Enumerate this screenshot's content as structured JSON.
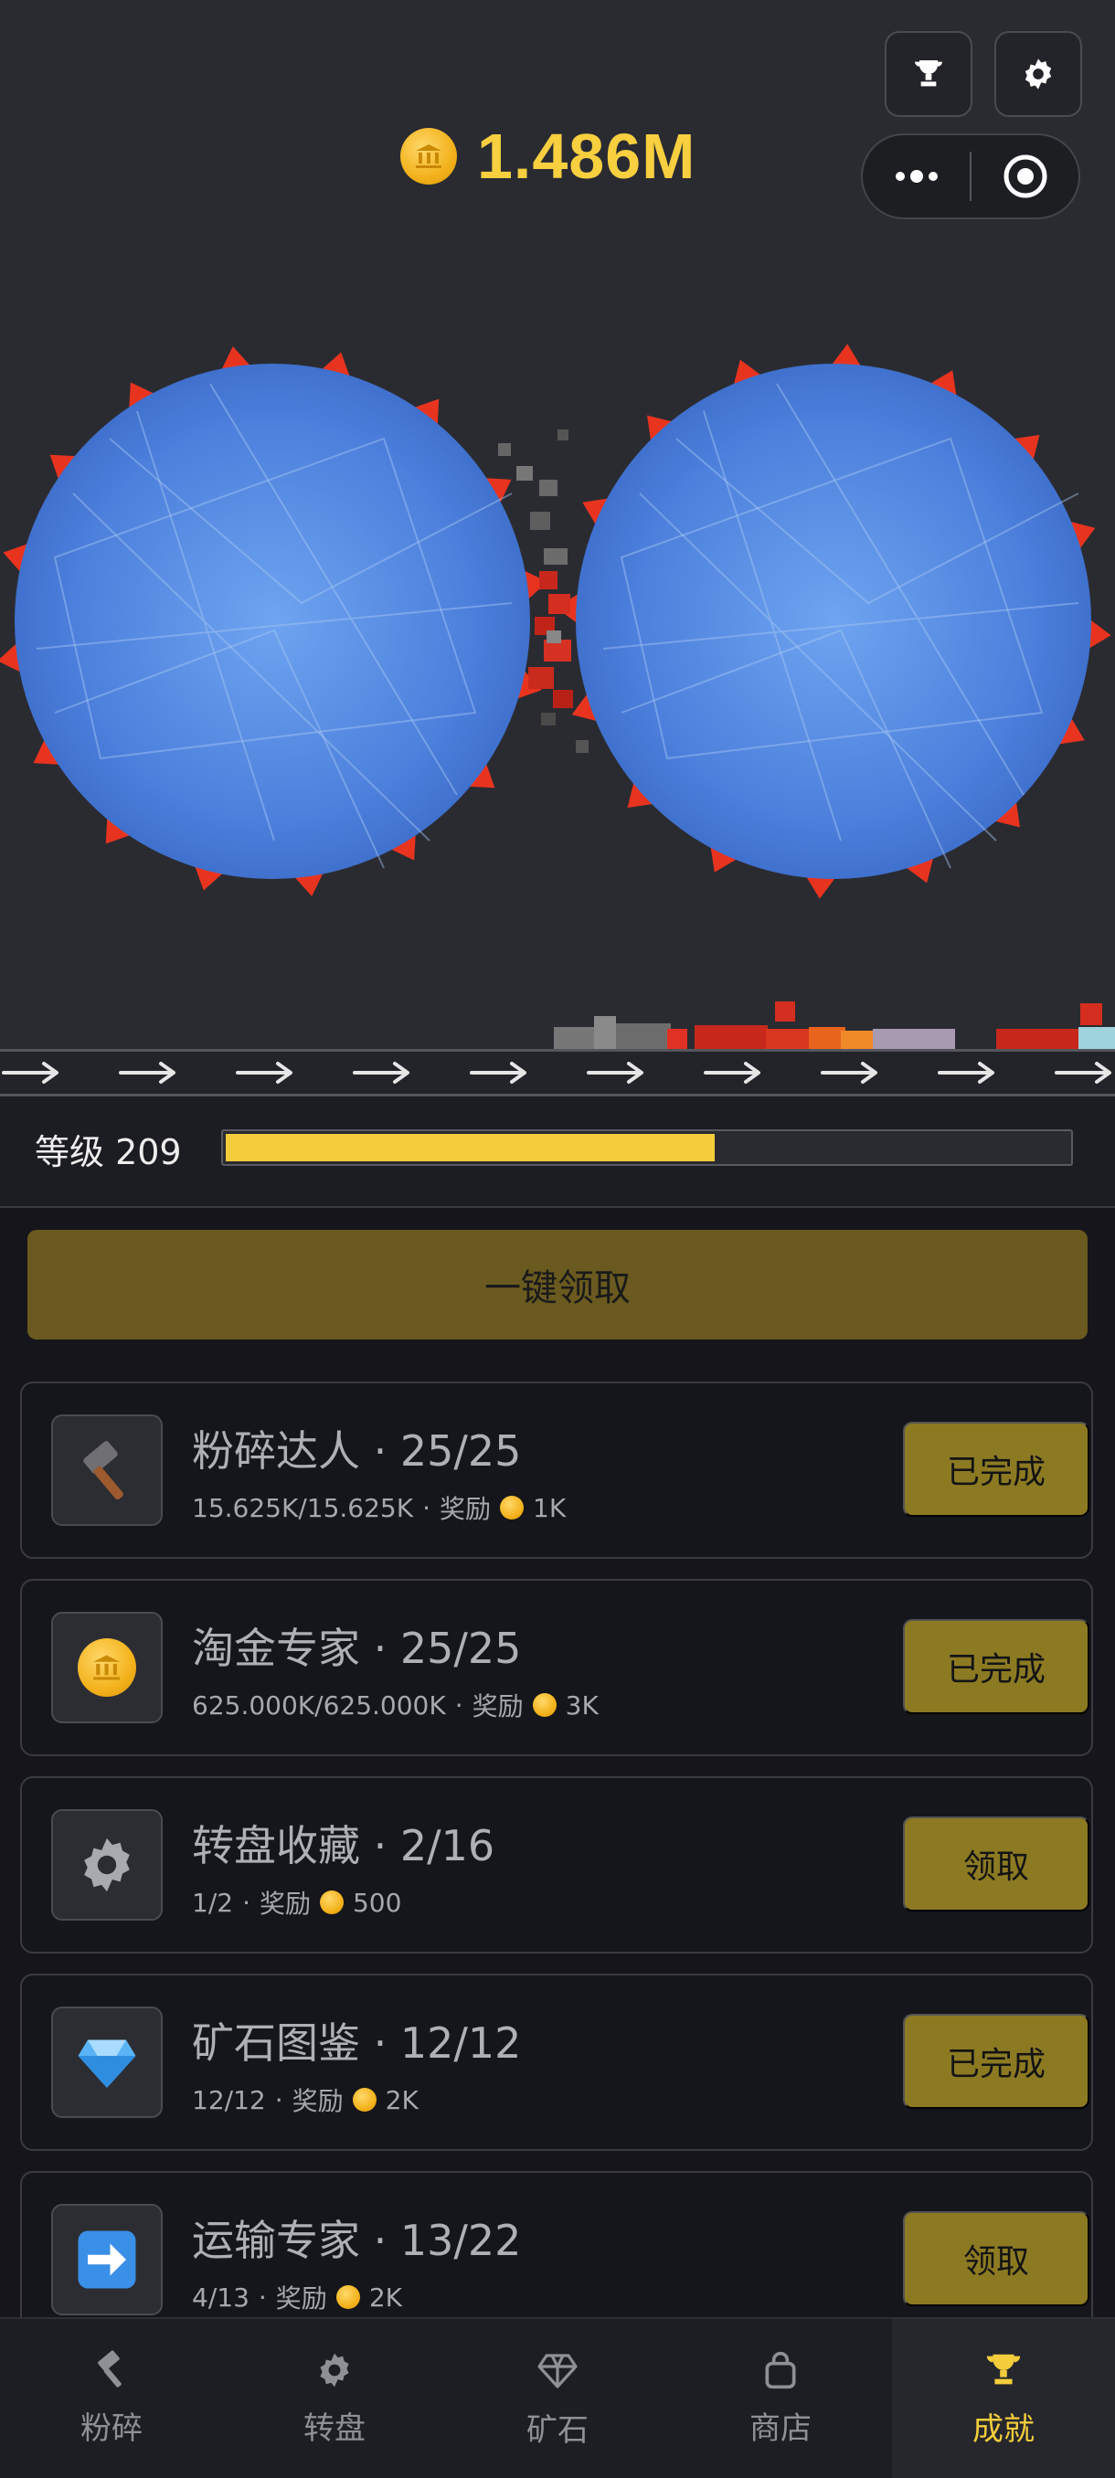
{
  "header": {
    "coins": "1.486M",
    "trophy_button_icon": "trophy-icon",
    "settings_button_icon": "gear-icon",
    "capsule": {
      "more_icon": "more-dots-icon",
      "close_icon": "target-icon"
    }
  },
  "level": {
    "label": "等级 209",
    "progress": 0.58
  },
  "claim_all": {
    "label": "一键领取"
  },
  "achievements": [
    {
      "icon": "hammer-icon",
      "title": "粉碎达人 · 25/25",
      "progress": "15.625K/15.625K",
      "reward_label": "奖励",
      "reward": "1K",
      "action": "已完成"
    },
    {
      "icon": "coin-icon",
      "title": "淘金专家 · 25/25",
      "progress": "625.000K/625.000K",
      "reward_label": "奖励",
      "reward": "3K",
      "action": "已完成"
    },
    {
      "icon": "gear-icon",
      "title": "转盘收藏 · 2/16",
      "progress": "1/2",
      "reward_label": "奖励",
      "reward": "500",
      "action": "领取"
    },
    {
      "icon": "diamond-icon",
      "title": "矿石图鉴 · 12/12",
      "progress": "12/12",
      "reward_label": "奖励",
      "reward": "2K",
      "action": "已完成"
    },
    {
      "icon": "arrow-right-icon",
      "title": "运输专家 · 13/22",
      "progress": "4/13",
      "reward_label": "奖励",
      "reward": "2K",
      "action": "领取"
    }
  ],
  "nav": [
    {
      "icon": "hammer-icon",
      "label": "粉碎",
      "active": false
    },
    {
      "icon": "gear-icon",
      "label": "转盘",
      "active": false
    },
    {
      "icon": "diamond-icon",
      "label": "矿石",
      "active": false
    },
    {
      "icon": "shopping-bag-icon",
      "label": "商店",
      "active": false
    },
    {
      "icon": "trophy-icon",
      "label": "成就",
      "active": true
    }
  ],
  "colors": {
    "accent": "#f3cd3b",
    "button": "#8c7a23",
    "claim_all": "#6a5a1f",
    "wheel_blue": "#4f86e0",
    "teeth": "#e8341f"
  }
}
